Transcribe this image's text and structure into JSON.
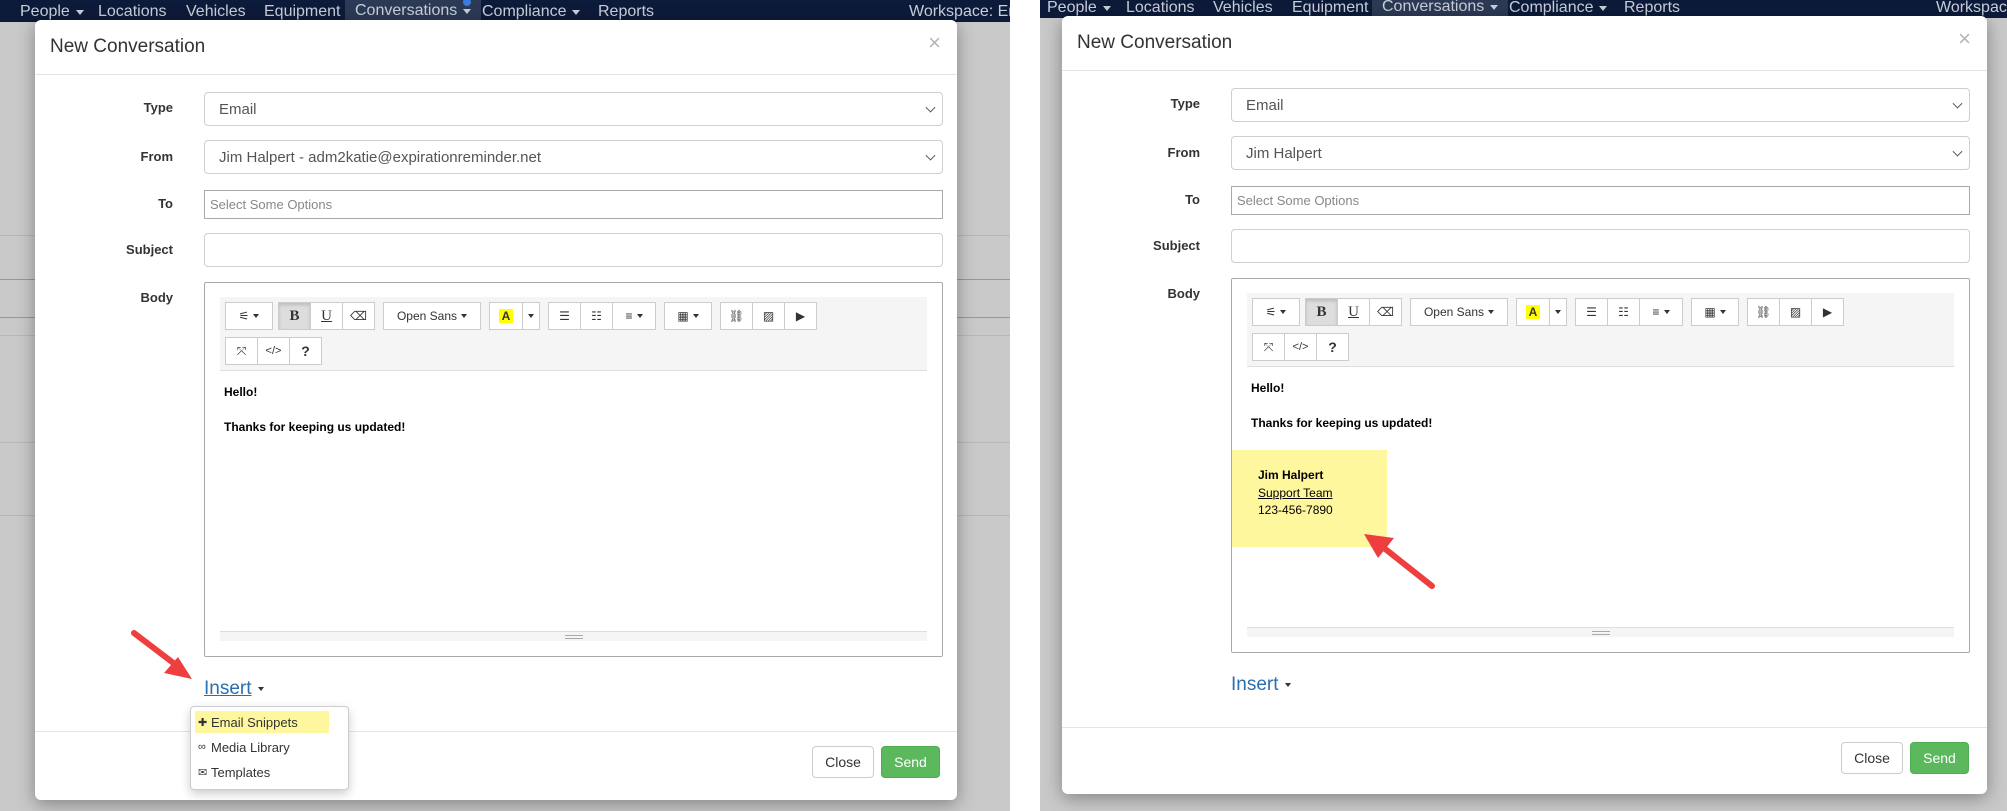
{
  "navbar": {
    "items": [
      "People",
      "Locations",
      "Vehicles",
      "Equipment",
      "Conversations",
      "Compliance",
      "Reports"
    ],
    "workspace_left": "Workspace: Em",
    "workspace_right": "Workspace"
  },
  "modal": {
    "title": "New Conversation",
    "close_symbol": "×",
    "labels": {
      "type": "Type",
      "from": "From",
      "to": "To",
      "subject": "Subject",
      "body": "Body"
    },
    "type_value": "Email",
    "to_placeholder": "Select Some Options",
    "subject_value": "",
    "toolbar": {
      "magic": "⚟",
      "bold": "B",
      "underline": "U",
      "eraser": "⌫",
      "font_name": "Open Sans",
      "color_letter": "A",
      "fullscreen": "⤧",
      "code": "</>",
      "help": "?"
    },
    "body_lines": [
      "Hello!",
      "Thanks for keeping us updated!"
    ],
    "insert_label": "Insert",
    "close_button": "Close",
    "send_button": "Send"
  },
  "left": {
    "from_value": "Jim Halpert - adm2katie@expirationreminder.net",
    "insert_menu": [
      "Email Snippets",
      "Media Library",
      "Templates"
    ]
  },
  "right": {
    "from_value": "Jim Halpert",
    "signature": {
      "name": "Jim Halpert",
      "team": "Support Team",
      "phone": "123-456-7890"
    }
  },
  "colors": {
    "navbar": "#0d1b3a",
    "highlight": "#fff79e",
    "send": "#5cb85c",
    "link": "#2a6fb0",
    "arrow": "#ef3e3e"
  }
}
